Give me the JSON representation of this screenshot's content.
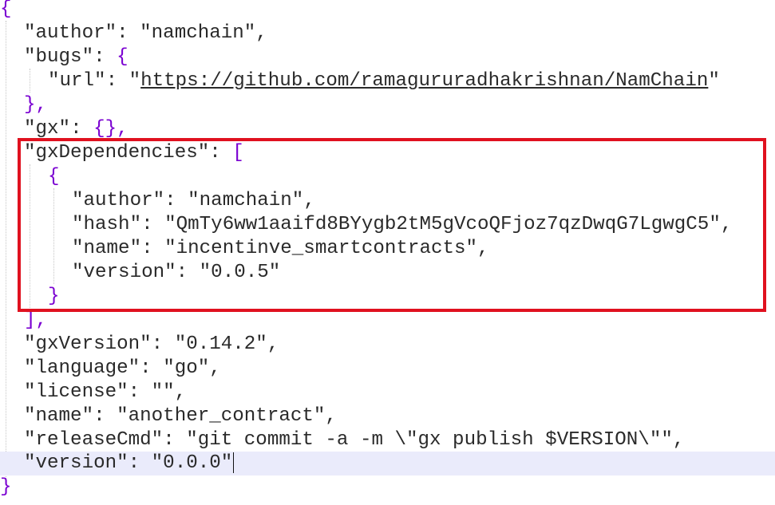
{
  "lines": [
    {
      "c1": "{"
    },
    {
      "k": "\"author\"",
      "sep": ": ",
      "v": "\"namchain\"",
      "tail": ","
    },
    {
      "k": "\"bugs\"",
      "sep": ": ",
      "p": "{"
    },
    {
      "k": "\"url\"",
      "sep": ": ",
      "q1": "\"",
      "u": "https://github.com/ramagururadhakrishnan/NamChain",
      "q2": "\""
    },
    {
      "p": "},"
    },
    {
      "k": "\"gx\"",
      "sep": ": ",
      "p": "{},"
    },
    {
      "k": "\"gxDependencies\"",
      "sep": ": ",
      "p": "["
    },
    {
      "p": "{"
    },
    {
      "k": "\"author\"",
      "sep": ": ",
      "v": "\"namchain\"",
      "tail": ","
    },
    {
      "k": "\"hash\"",
      "sep": ": ",
      "v": "\"QmTy6ww1aaifd8BYygb2tM5gVcoQFjoz7qzDwqG7LgwgC5\"",
      "tail": ","
    },
    {
      "k": "\"name\"",
      "sep": ": ",
      "v": "\"incentinve_smartcontracts\"",
      "tail": ","
    },
    {
      "k": "\"version\"",
      "sep": ": ",
      "v": "\"0.0.5\""
    },
    {
      "p": "}"
    },
    {
      "p": "],"
    },
    {
      "k": "\"gxVersion\"",
      "sep": ": ",
      "v": "\"0.14.2\"",
      "tail": ","
    },
    {
      "k": "\"language\"",
      "sep": ": ",
      "v": "\"go\"",
      "tail": ","
    },
    {
      "k": "\"license\"",
      "sep": ": ",
      "v": "\"\"",
      "tail": ","
    },
    {
      "k": "\"name\"",
      "sep": ": ",
      "v": "\"another_contract\"",
      "tail": ","
    },
    {
      "k": "\"releaseCmd\"",
      "sep": ": ",
      "v": "\"git commit -a -m \\\"gx publish $VERSION\\\"\"",
      "tail": ","
    },
    {
      "k": "\"version\"",
      "sep": ": ",
      "v": "\"0.0.0\""
    },
    {
      "c1": "}"
    }
  ],
  "colors": {
    "punctuation": "#7a00d1",
    "text": "#2a2a2a",
    "current_line": "#eaebfb",
    "highlight_border": "#e0111f"
  }
}
